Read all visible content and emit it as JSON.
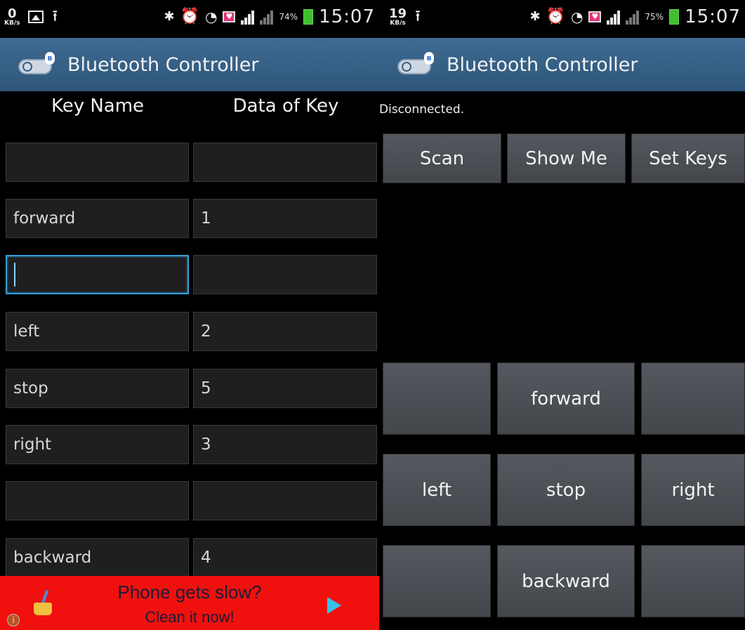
{
  "left_screen": {
    "statusbar": {
      "kbs_value": "0",
      "kbs_unit": "KB/s",
      "battery_percent": "74%",
      "clock": "15:07",
      "icons": [
        "picture-icon",
        "upload-icon",
        "bluetooth-icon",
        "alarm-icon",
        "wifi-icon",
        "notification-icon",
        "signal-icon",
        "battery-icon"
      ]
    },
    "actionbar": {
      "title": "Bluetooth Controller"
    },
    "headers": {
      "key_name": "Key Name",
      "data_of_key": "Data of Key"
    },
    "rows": [
      {
        "key": "",
        "value": ""
      },
      {
        "key": "forward",
        "value": "1"
      },
      {
        "key": "",
        "value": ""
      },
      {
        "key": "left",
        "value": "2"
      },
      {
        "key": "stop",
        "value": "5"
      },
      {
        "key": "right",
        "value": "3"
      },
      {
        "key": "",
        "value": ""
      },
      {
        "key": "backward",
        "value": "4"
      }
    ],
    "ad": {
      "line1": "Phone gets slow?",
      "line2": "Clean it now!"
    }
  },
  "right_screen": {
    "statusbar": {
      "kbs_value": "19",
      "kbs_unit": "KB/s",
      "battery_percent": "75%",
      "clock": "15:07"
    },
    "actionbar": {
      "title": "Bluetooth Controller"
    },
    "connection_status": "Disconnected.",
    "top_buttons": {
      "scan": "Scan",
      "show_me": "Show Me",
      "set_keys": "Set Keys"
    },
    "pad": {
      "top_left": "",
      "forward": "forward",
      "top_right": "",
      "left": "left",
      "stop": "stop",
      "right": "right",
      "bottom_left": "",
      "backward": "backward",
      "bottom_right": ""
    }
  },
  "colors": {
    "actionbar": "#35607f",
    "focus_border": "#3a9ed9",
    "ad_background": "#f0110e",
    "battery": "#3fbf2f"
  }
}
